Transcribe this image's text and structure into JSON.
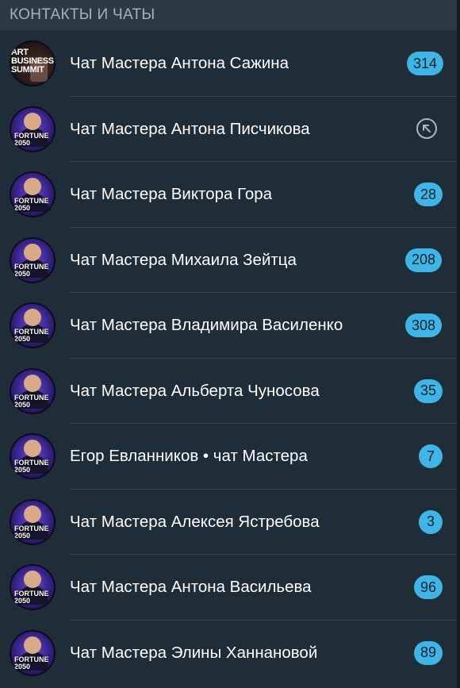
{
  "section": {
    "title": "КОНТАКТЫ И ЧАТЫ"
  },
  "avatar_labels": {
    "abs": "ART BUSINESS SUMMIT",
    "fortune": "FORTUNE 2050"
  },
  "chats": [
    {
      "title": "Чат Мастера Антона Сажина",
      "badge": "314",
      "avatar": "abs"
    },
    {
      "title": "Чат Мастера Антона Писчикова",
      "badge": "",
      "avatar": "fortune",
      "icon": "arrow-up-left-circle-icon"
    },
    {
      "title": "Чат Мастера Виктора Гора",
      "badge": "28",
      "avatar": "fortune"
    },
    {
      "title": "Чат Мастера Михаила Зейтца",
      "badge": "208",
      "avatar": "fortune"
    },
    {
      "title": "Чат Мастера Владимира Василенко",
      "badge": "308",
      "avatar": "fortune"
    },
    {
      "title": "Чат Мастера Альберта Чуносова",
      "badge": "35",
      "avatar": "fortune"
    },
    {
      "title": "Егор Евланников • чат Мастера",
      "badge": "7",
      "avatar": "fortune"
    },
    {
      "title": "Чат Мастера Алексея Ястребова",
      "badge": "3",
      "avatar": "fortune"
    },
    {
      "title": "Чат Мастера Антона Васильева",
      "badge": "96",
      "avatar": "fortune"
    },
    {
      "title": "Чат Мастера Элины Ханнановой",
      "badge": "89",
      "avatar": "fortune"
    }
  ],
  "colors": {
    "background": "#1f2d38",
    "header_background": "#2c3a46",
    "badge": "#3fb5e6",
    "text": "#ffffff"
  }
}
